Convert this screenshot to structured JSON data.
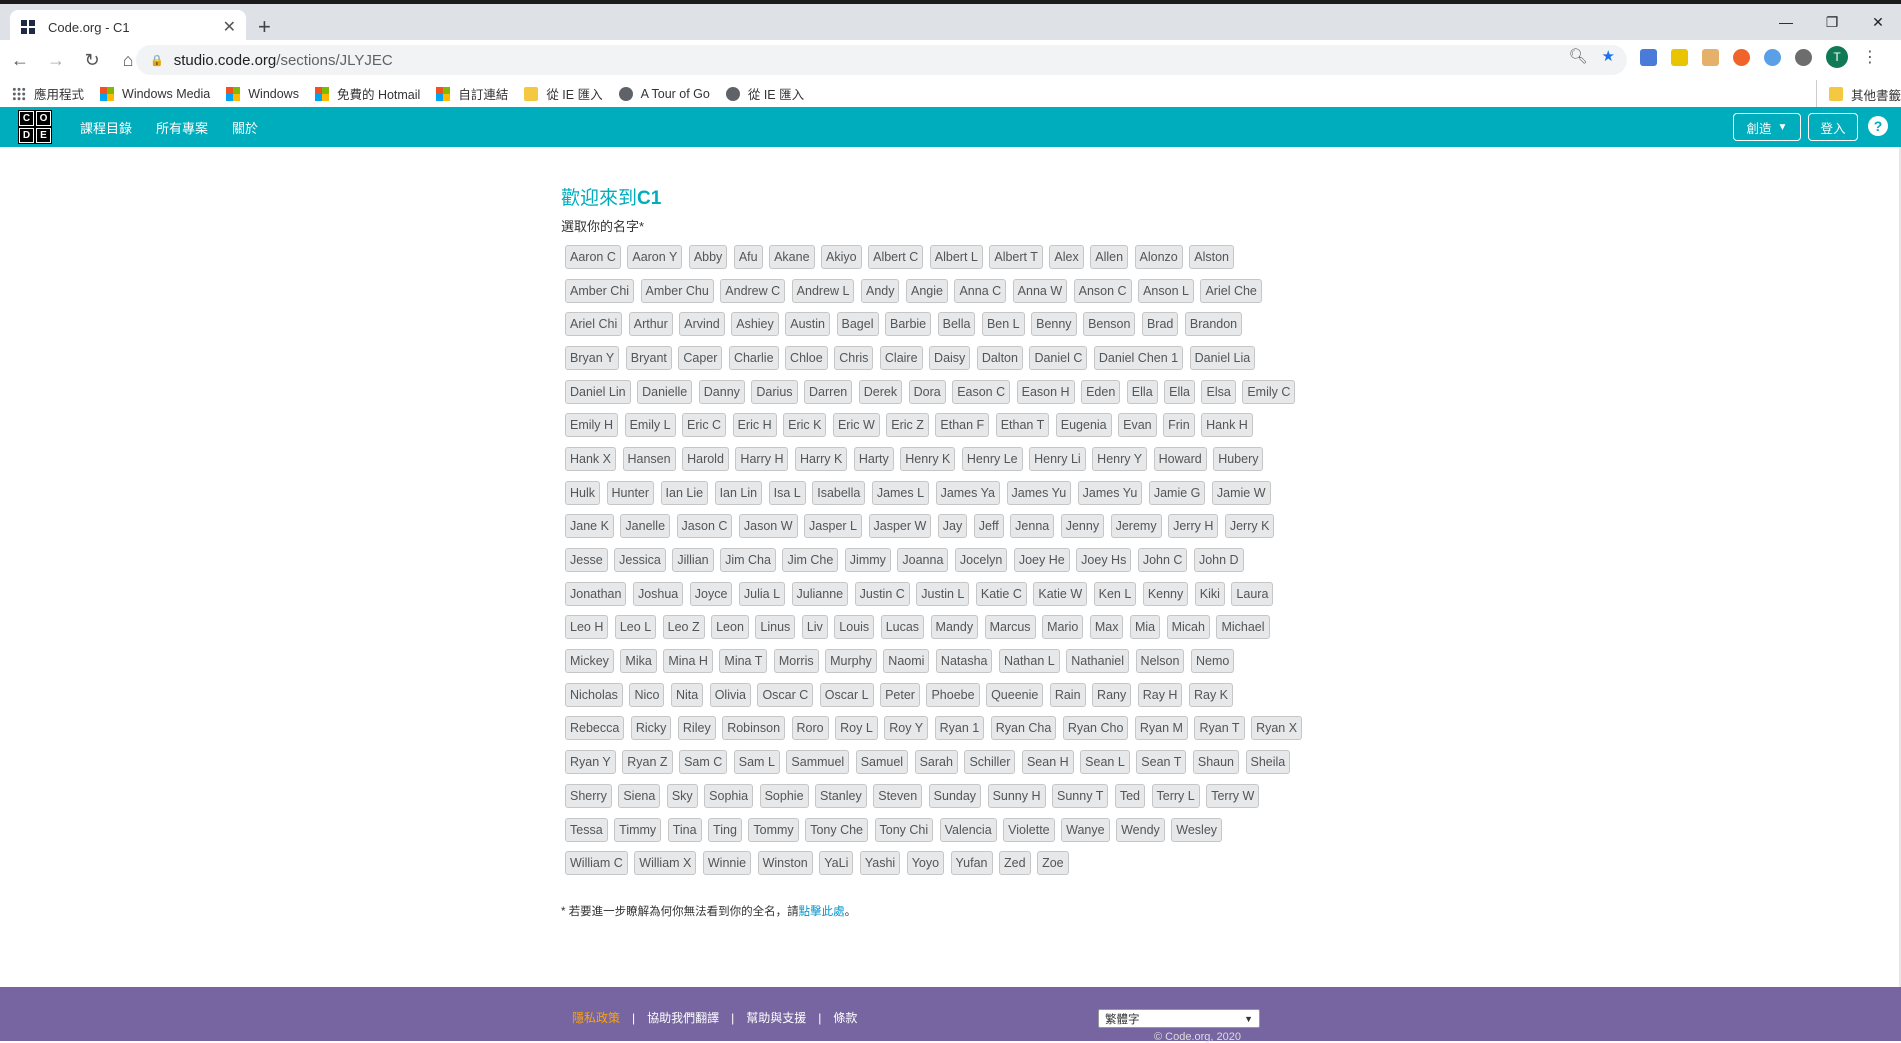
{
  "browser": {
    "tab_title": "Code.org - C1",
    "new_tab": "+",
    "url_host": "studio.code.org",
    "url_path": "/sections/JLYJEC",
    "avatar_letter": "T",
    "bookmarks": [
      {
        "label": "應用程式",
        "icon": "apps"
      },
      {
        "label": "Windows Media",
        "icon": "ms"
      },
      {
        "label": "Windows",
        "icon": "ms"
      },
      {
        "label": "免費的 Hotmail",
        "icon": "ms"
      },
      {
        "label": "自訂連結",
        "icon": "ms"
      },
      {
        "label": "從 IE 匯入",
        "icon": "folder"
      },
      {
        "label": "A Tour of Go",
        "icon": "globe"
      },
      {
        "label": "從 IE 匯入",
        "icon": "globe"
      }
    ],
    "bookmark_other": "其他書籤"
  },
  "site": {
    "logo": [
      "C",
      "O",
      "D",
      "E"
    ],
    "nav": [
      "課程目錄",
      "所有專案",
      "關於"
    ],
    "create_label": "創造",
    "signin_label": "登入",
    "help_label": "?"
  },
  "main": {
    "heading_prefix": "歡迎來到",
    "heading_section": "C1",
    "subheading": "選取你的名字*",
    "names": [
      [
        "Aaron C",
        "Aaron Y",
        "Abby",
        "Afu",
        "Akane",
        "Akiyo",
        "Albert C",
        "Albert L",
        "Albert T",
        "Alex",
        "Allen",
        "Alonzo",
        "Alston"
      ],
      [
        "Amber Chi",
        "Amber Chu",
        "Andrew C",
        "Andrew L",
        "Andy",
        "Angie",
        "Anna C",
        "Anna W",
        "Anson C",
        "Anson L",
        "Ariel Che"
      ],
      [
        "Ariel Chi",
        "Arthur",
        "Arvind",
        "Ashiey",
        "Austin",
        "Bagel",
        "Barbie",
        "Bella",
        "Ben L",
        "Benny",
        "Benson",
        "Brad",
        "Brandon"
      ],
      [
        "Bryan Y",
        "Bryant",
        "Caper",
        "Charlie",
        "Chloe",
        "Chris",
        "Claire",
        "Daisy",
        "Dalton",
        "Daniel C",
        "Daniel Chen 1",
        "Daniel Lia"
      ],
      [
        "Daniel Lin",
        "Danielle",
        "Danny",
        "Darius",
        "Darren",
        "Derek",
        "Dora",
        "Eason C",
        "Eason H",
        "Eden",
        "Ella",
        "Ella",
        "Elsa",
        "Emily C"
      ],
      [
        "Emily H",
        "Emily L",
        "Eric C",
        "Eric H",
        "Eric K",
        "Eric W",
        "Eric Z",
        "Ethan F",
        "Ethan T",
        "Eugenia",
        "Evan",
        "Frin",
        "Hank H"
      ],
      [
        "Hank X",
        "Hansen",
        "Harold",
        "Harry H",
        "Harry K",
        "Harty",
        "Henry K",
        "Henry Le",
        "Henry Li",
        "Henry Y",
        "Howard",
        "Hubery"
      ],
      [
        "Hulk",
        "Hunter",
        "Ian Lie",
        "Ian Lin",
        "Isa L",
        "Isabella",
        "James L",
        "James Ya",
        "James Yu",
        "James Yu",
        "Jamie G",
        "Jamie W"
      ],
      [
        "Jane K",
        "Janelle",
        "Jason C",
        "Jason W",
        "Jasper L",
        "Jasper W",
        "Jay",
        "Jeff",
        "Jenna",
        "Jenny",
        "Jeremy",
        "Jerry H",
        "Jerry K"
      ],
      [
        "Jesse",
        "Jessica",
        "Jillian",
        "Jim Cha",
        "Jim Che",
        "Jimmy",
        "Joanna",
        "Jocelyn",
        "Joey He",
        "Joey Hs",
        "John C",
        "John D"
      ],
      [
        "Jonathan",
        "Joshua",
        "Joyce",
        "Julia L",
        "Julianne",
        "Justin C",
        "Justin L",
        "Katie C",
        "Katie W",
        "Ken L",
        "Kenny",
        "Kiki",
        "Laura"
      ],
      [
        "Leo H",
        "Leo L",
        "Leo Z",
        "Leon",
        "Linus",
        "Liv",
        "Louis",
        "Lucas",
        "Mandy",
        "Marcus",
        "Mario",
        "Max",
        "Mia",
        "Micah",
        "Michael"
      ],
      [
        "Mickey",
        "Mika",
        "Mina H",
        "Mina T",
        "Morris",
        "Murphy",
        "Naomi",
        "Natasha",
        "Nathan L",
        "Nathaniel",
        "Nelson",
        "Nemo"
      ],
      [
        "Nicholas",
        "Nico",
        "Nita",
        "Olivia",
        "Oscar C",
        "Oscar L",
        "Peter",
        "Phoebe",
        "Queenie",
        "Rain",
        "Rany",
        "Ray H",
        "Ray K"
      ],
      [
        "Rebecca",
        "Ricky",
        "Riley",
        "Robinson",
        "Roro",
        "Roy L",
        "Roy Y",
        "Ryan 1",
        "Ryan Cha",
        "Ryan Cho",
        "Ryan M",
        "Ryan T",
        "Ryan X"
      ],
      [
        "Ryan Y",
        "Ryan Z",
        "Sam C",
        "Sam L",
        "Sammuel",
        "Samuel",
        "Sarah",
        "Schiller",
        "Sean H",
        "Sean L",
        "Sean T",
        "Shaun",
        "Sheila"
      ],
      [
        "Sherry",
        "Siena",
        "Sky",
        "Sophia",
        "Sophie",
        "Stanley",
        "Steven",
        "Sunday",
        "Sunny H",
        "Sunny T",
        "Ted",
        "Terry L",
        "Terry W"
      ],
      [
        "Tessa",
        "Timmy",
        "Tina",
        "Ting",
        "Tommy",
        "Tony Che",
        "Tony Chi",
        "Valencia",
        "Violette",
        "Wanye",
        "Wendy",
        "Wesley"
      ],
      [
        "William C",
        "William X",
        "Winnie",
        "Winston",
        "YaLi",
        "Yashi",
        "Yoyo",
        "Yufan",
        "Zed",
        "Zoe"
      ]
    ],
    "footnote_text": "* 若要進一步瞭解為何你無法看到你的全名，請",
    "footnote_link": "點擊此處",
    "footnote_end": "。"
  },
  "footer": {
    "links": [
      "隱私政策",
      "協助我們翻譯",
      "幫助與支援",
      "條款"
    ],
    "language": "繁體字",
    "copyright": "© Code.org, 2020"
  },
  "colors": {
    "brand_teal": "#00adbc",
    "footer_purple": "#7665a0",
    "privacy_orange": "#ffa400"
  }
}
